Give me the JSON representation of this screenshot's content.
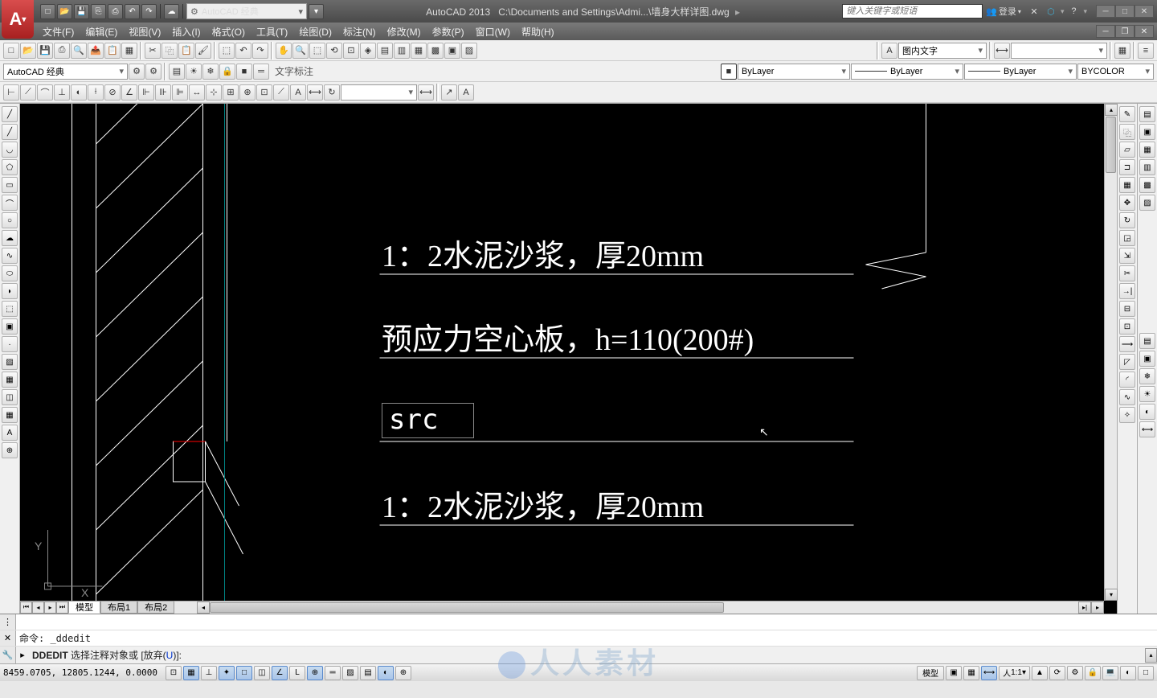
{
  "app": {
    "name": "AutoCAD 2013",
    "filepath": "C:\\Documents and Settings\\Admi...\\墙身大样详图.dwg",
    "search_placeholder": "键入关键字或短语",
    "login": "登录",
    "workspace_combo": "AutoCAD 经典",
    "workspace_combo2": "AutoCAD 经典"
  },
  "menu": {
    "items": [
      "文件(F)",
      "编辑(E)",
      "视图(V)",
      "插入(I)",
      "格式(O)",
      "工具(T)",
      "绘图(D)",
      "标注(N)",
      "修改(M)",
      "参数(P)",
      "窗口(W)",
      "帮助(H)"
    ]
  },
  "toolbar3": {
    "text_style": "图内文字",
    "layer_combo": "ByLayer",
    "lineweight": "ByLayer",
    "linetype": "ByLayer",
    "color": "BYCOLOR",
    "annotation_label": "文字标注"
  },
  "tabs": {
    "items": [
      "模型",
      "布局1",
      "布局2"
    ],
    "active": 0
  },
  "canvas": {
    "texts": [
      {
        "id": "t1",
        "text": "1：2水泥沙浆，厚20mm"
      },
      {
        "id": "t2",
        "text": "预应力空心板，h=110(200#)"
      },
      {
        "id": "t3",
        "text": "src"
      },
      {
        "id": "t4",
        "text": "1：2水泥沙浆，厚20mm"
      }
    ],
    "ucs": {
      "x": "X",
      "y": "Y"
    }
  },
  "cmdline": {
    "history": "命令: _ddedit",
    "prompt_prefix": "DDEDIT",
    "prompt_text": " 选择注释对象或 [放弃(",
    "prompt_hl": "U",
    "prompt_suffix": ")]:"
  },
  "statusbar": {
    "coords": "8459.0705, 12805.1244, 0.0000",
    "model_label": "模型",
    "scale": "1:1"
  },
  "watermark": "人人素材"
}
